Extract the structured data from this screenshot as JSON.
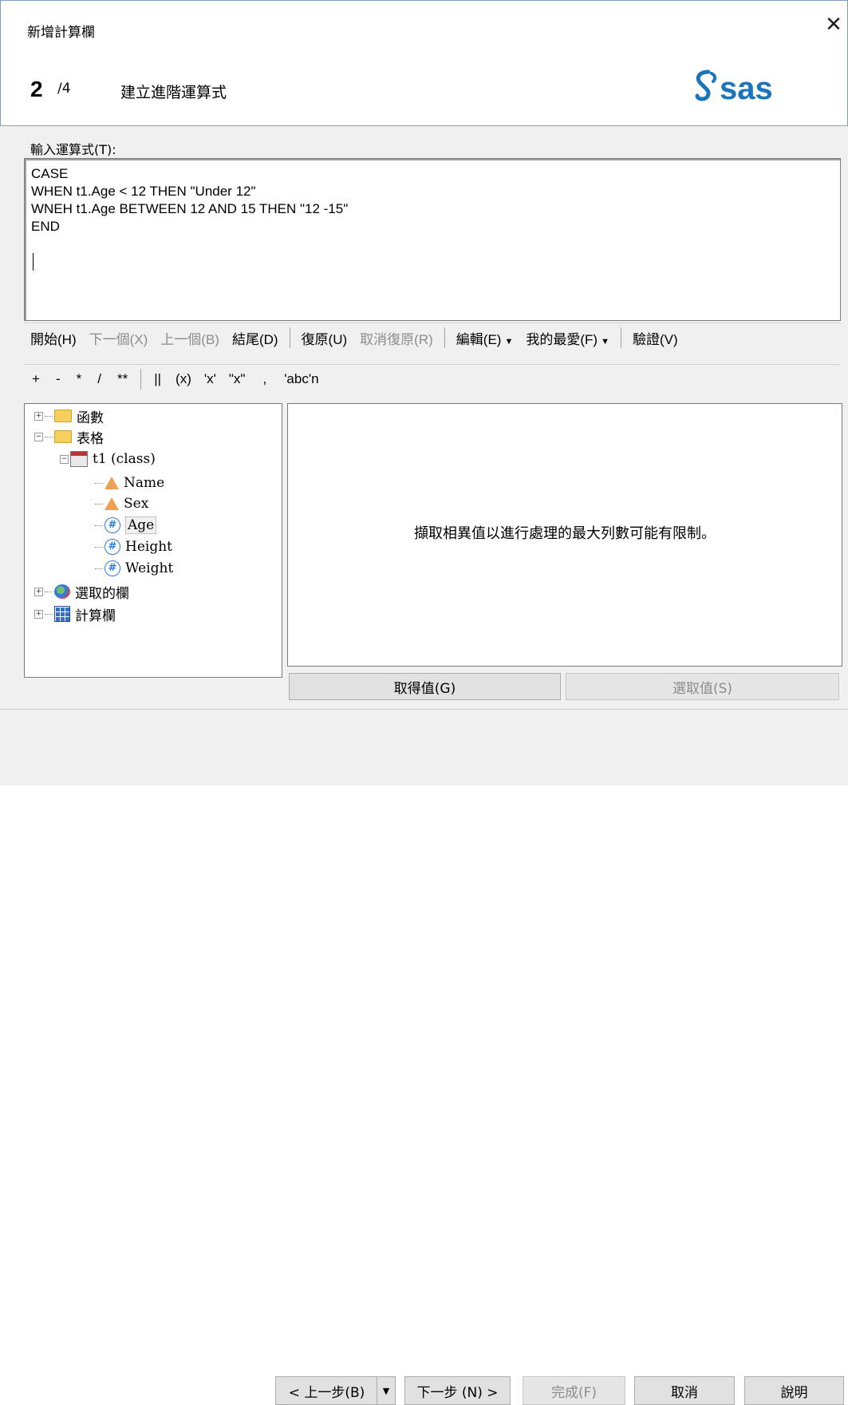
{
  "window": {
    "title": "新增計算欄",
    "close_glyph": "✕"
  },
  "header": {
    "step_current": "2",
    "step_total": "/4",
    "step_title": "建立進階運算式",
    "logo_text": "sas"
  },
  "expression": {
    "label": "輸入運算式(T):",
    "text": "CASE\nWHEN t1.Age < 12 THEN \"Under 12\"\nWNEH t1.Age BETWEEN 12 AND 15 THEN \"12 -15\"\nEND"
  },
  "toolbar1": {
    "start": "開始(H)",
    "next": "下一個(X)",
    "prev": "上一個(B)",
    "end": "結尾(D)",
    "undo": "復原(U)",
    "redo": "取消復原(R)",
    "edit": "編輯(E)",
    "favorites": "我的最愛(F)",
    "validate": "驗證(V)"
  },
  "toolbar2": {
    "ops": [
      "+",
      "-",
      "*",
      "/",
      "**",
      "||",
      "(x)",
      "'x'",
      "\"x\"",
      ",",
      "'abc'n"
    ]
  },
  "tree": {
    "functions": "函數",
    "tables": "表格",
    "table_t1": "t1 (class)",
    "columns": [
      "Name",
      "Sex",
      "Age",
      "Height",
      "Weight"
    ],
    "selected_columns": "選取的欄",
    "computed_columns": "計算欄"
  },
  "right_panel": {
    "message": "擷取相異值以進行處理的最大列數可能有限制。",
    "get_values": "取得值(G)",
    "select_value": "選取值(S)"
  },
  "footer": {
    "back": "< 上一步(B)",
    "next": "下一步 (N) >",
    "finish": "完成(F)",
    "cancel": "取消",
    "help": "說明"
  }
}
